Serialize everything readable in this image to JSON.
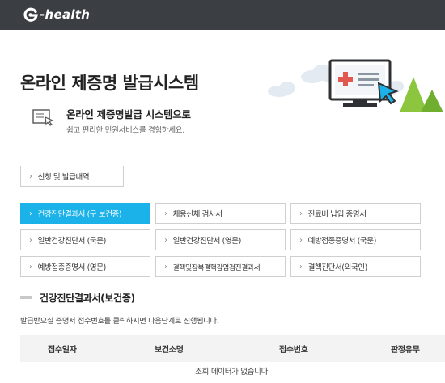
{
  "header": {
    "brand": "-health",
    "logo_icon": "g-swirl-logo-icon",
    "bg_color": "#3b3e43"
  },
  "page": {
    "title": "온라인 제증명 발급시스템",
    "illustration": "monitor-with-cursor-illustration"
  },
  "intro": {
    "icon": "document-cursor-icon",
    "title": "온라인 제증명발급 시스템으로",
    "subtitle": "쉽고 편리한 민원서비스를 경험하세요."
  },
  "history_button": {
    "label": "신청 및 발급내역",
    "icon": "chevron-right-icon"
  },
  "certificates": [
    {
      "label": "건강진단결과서 (구 보건증)",
      "active": true
    },
    {
      "label": "채용신체 검사서",
      "active": false
    },
    {
      "label": "진료비 납입 증명서",
      "active": false
    },
    {
      "label": "일반건강진단서 (국문)",
      "active": false
    },
    {
      "label": "일반건강진단서 (영문)",
      "active": false
    },
    {
      "label": "예방접종증명서 (국문)",
      "active": false
    },
    {
      "label": "예방접종증명서 (영문)",
      "active": false
    },
    {
      "label": "결핵및잠복결핵감염검진결과서",
      "active": false
    },
    {
      "label": "결핵진단서(외국인)",
      "active": false
    }
  ],
  "section": {
    "title": "건강진단결과서(보건증)",
    "notice": "발급받으실 증명서 접수번호를 클릭하시면 다음단계로 진행됩니다."
  },
  "table": {
    "columns": [
      "접수일자",
      "보건소명",
      "접수번호",
      "판정유무"
    ],
    "empty_message": "조회 데이터가 없습니다."
  },
  "colors": {
    "accent": "#1ab2e8",
    "illustration_green": "#8cc63f"
  }
}
